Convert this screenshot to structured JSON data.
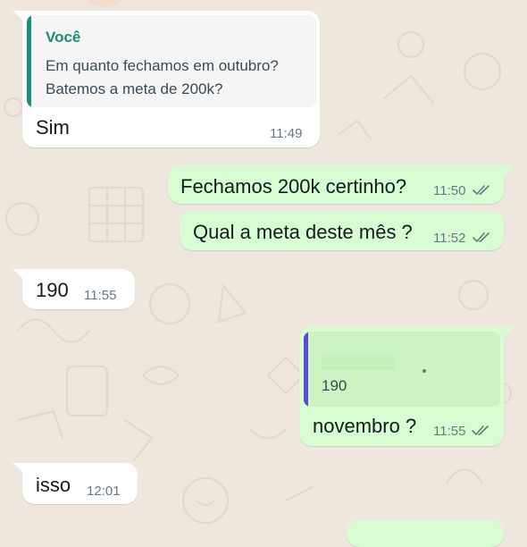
{
  "colors": {
    "background": "#efe7de",
    "incoming": "#ffffff",
    "outgoing": "#d9fdd3",
    "quote_in_bar": "#1a8c7a",
    "quote_out_bar": "#5b48d4",
    "sender_name": "#1a8c7a",
    "ticks": "#667781"
  },
  "messages": [
    {
      "direction": "incoming",
      "quote": {
        "sender": "Você",
        "line1": "Em quanto fechamos em outubro?",
        "line2": "Batemos a meta de 200k?"
      },
      "text": "Sim",
      "time": "11:49"
    },
    {
      "direction": "outgoing",
      "text": "Fechamos 200k certinho?",
      "time": "11:50",
      "status": "read-ticks-icon"
    },
    {
      "direction": "outgoing",
      "text": "Qual a meta deste mês ?",
      "time": "11:52",
      "status": "read-ticks-icon"
    },
    {
      "direction": "incoming",
      "text": "190",
      "time": "11:55"
    },
    {
      "direction": "outgoing",
      "quote": {
        "text": "190"
      },
      "text": "novembro ?",
      "time": "11:55",
      "status": "read-ticks-icon"
    },
    {
      "direction": "incoming",
      "text": "isso",
      "time": "12:01"
    }
  ]
}
